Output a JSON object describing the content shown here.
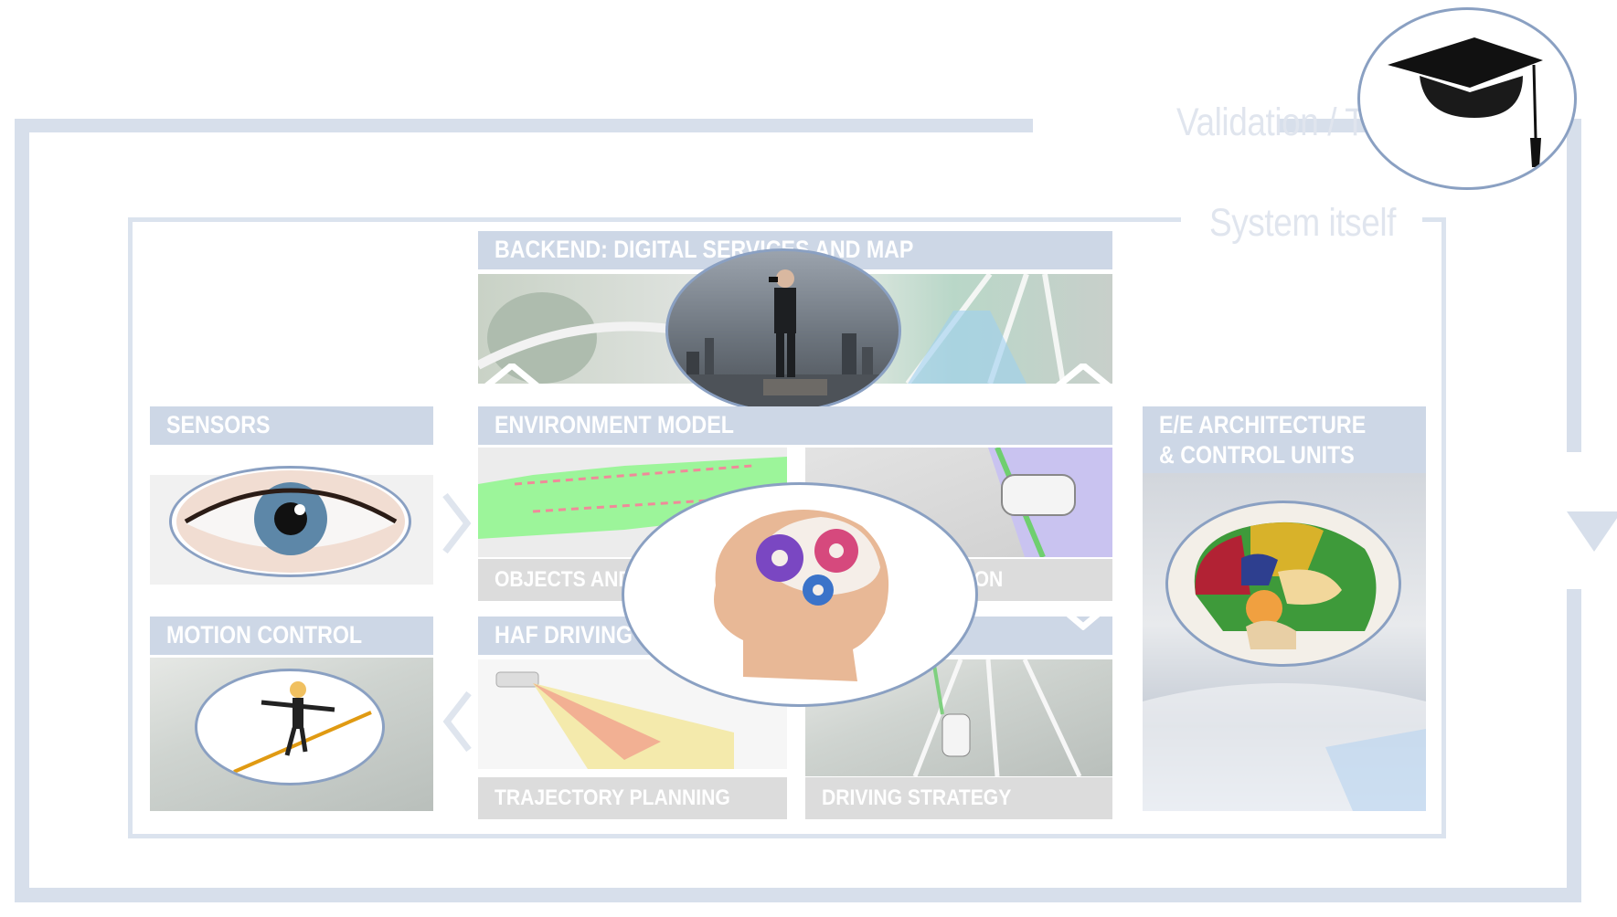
{
  "frames": {
    "outer_label": "Validation / T",
    "inner_label": "System itself"
  },
  "sections": {
    "backend": "BACKEND: DIGITAL SERVICES AND MAP",
    "environment": "ENVIRONMENT MODEL",
    "sensors": "SENSORS",
    "motion": "MOTION CONTROL",
    "ee_line1": "E/E ARCHITECTURE",
    "ee_line2": "& CONTROL UNITS",
    "haf": "HAF DRIVING"
  },
  "subsections": {
    "objects": "OBJECTS AND",
    "location": "TION",
    "trajectory": "TRAJECTORY PLANNING",
    "strategy": "DRIVING STRATEGY"
  },
  "icons": {
    "grad_cap": "graduation-cap-icon",
    "binoculars_man": "man-with-binoculars-image",
    "eye": "eye-image",
    "tightrope": "tightrope-walker-image",
    "head_gears": "head-with-gears-icon",
    "brain": "brain-model-image"
  },
  "colors": {
    "frame": "#d7dfeb",
    "header": "#cdd7e6",
    "subheader": "#dcdcdc",
    "oval_border": "#8aa0c2"
  }
}
